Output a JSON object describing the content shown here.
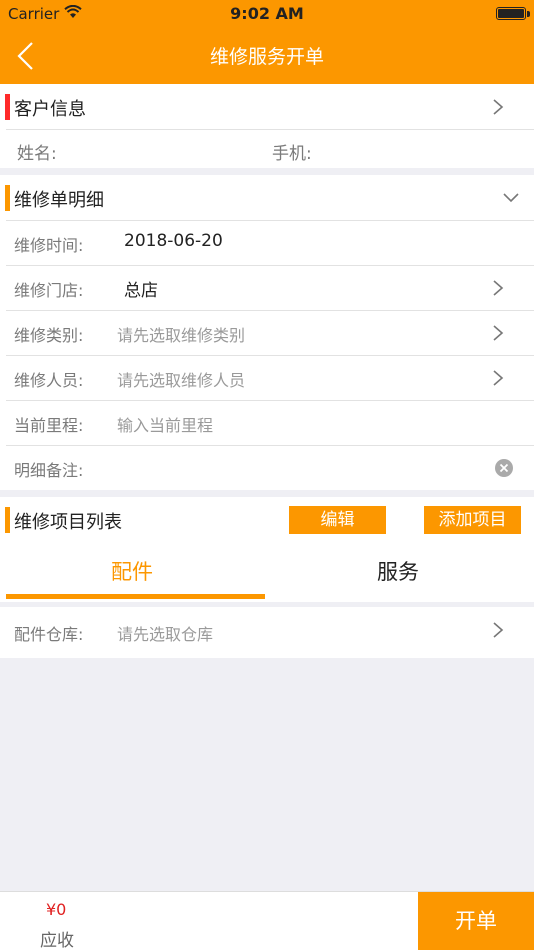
{
  "status_bar": {
    "carrier": "Carrier",
    "time": "9:02 AM"
  },
  "nav": {
    "title": "维修服务开单"
  },
  "customer": {
    "title": "客户信息",
    "name_label": "姓名:",
    "phone_label": "手机:"
  },
  "details": {
    "title": "维修单明细",
    "time_label": "维修时间:",
    "time_value": "2018-06-20",
    "store_label": "维修门店:",
    "store_value": "总店",
    "type_label": "维修类别:",
    "type_placeholder": "请先选取维修类别",
    "staff_label": "维修人员:",
    "staff_placeholder": "请先选取维修人员",
    "mileage_label": "当前里程:",
    "mileage_placeholder": "输入当前里程",
    "remark_label": "明细备注:"
  },
  "items": {
    "title": "维修项目列表",
    "edit_label": "编辑",
    "add_label": "添加项目"
  },
  "tabs": [
    {
      "label": "配件",
      "active": true
    },
    {
      "label": "服务",
      "active": false
    }
  ],
  "warehouse": {
    "label": "配件仓库:",
    "placeholder": "请先选取仓库"
  },
  "bottom": {
    "amount": "¥0",
    "amount_label": "应收",
    "submit_label": "开单"
  },
  "colors": {
    "accent": "#fc9700",
    "red_marker": "#ff2a2a",
    "amount": "#e02020"
  },
  "icons": [
    "back-icon",
    "chevron-right-icon",
    "chevron-down-icon",
    "clear-icon",
    "wifi-icon",
    "battery-icon"
  ]
}
